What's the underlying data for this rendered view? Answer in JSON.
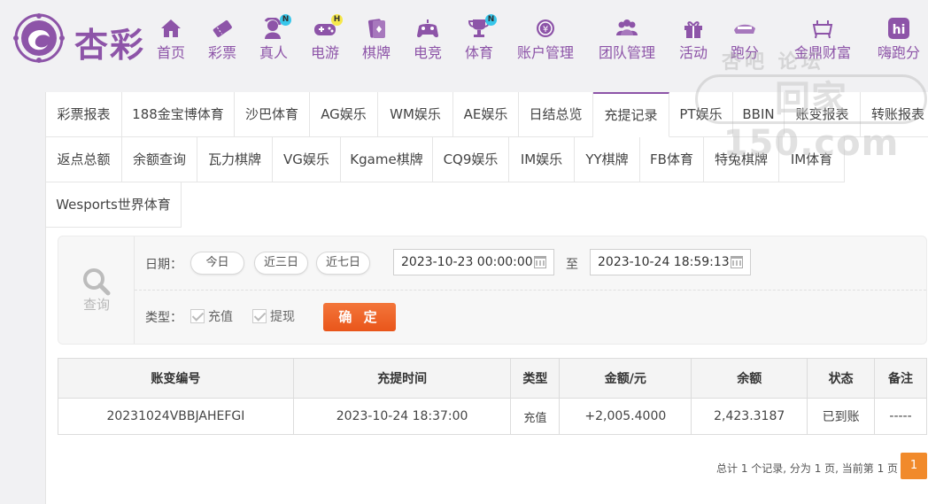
{
  "brand": {
    "name": "杏彩"
  },
  "nav": [
    {
      "label": "首页",
      "icon": "home-icon"
    },
    {
      "label": "彩票",
      "icon": "lottery-ticket-icon"
    },
    {
      "label": "真人",
      "icon": "live-dealer-icon",
      "badge": "N"
    },
    {
      "label": "电游",
      "icon": "gamepad-icon",
      "badge": "H"
    },
    {
      "label": "棋牌",
      "icon": "cards-icon"
    },
    {
      "label": "电竞",
      "icon": "esports-controller-icon"
    },
    {
      "label": "体育",
      "icon": "trophy-icon",
      "badge": "N"
    },
    {
      "label": "账户管理",
      "icon": "yen-coin-icon"
    },
    {
      "label": "团队管理",
      "icon": "team-icon"
    },
    {
      "label": "活动",
      "icon": "gift-icon"
    },
    {
      "label": "跑分",
      "icon": "running-icon"
    },
    {
      "label": "金鼎财富",
      "icon": "cauldron-icon"
    },
    {
      "label": "嗨跑分",
      "icon": "hi-app-icon"
    }
  ],
  "watermark": {
    "line1": "杏吧 论坛",
    "line2": "回家150.com"
  },
  "tabs": [
    "彩票报表",
    "188金宝博体育",
    "沙巴体育",
    "AG娱乐",
    "WM娱乐",
    "AE娱乐",
    "日结总览",
    "充提记录",
    "PT娱乐",
    "BBIN",
    "账变报表",
    "转账报表",
    "返点总额",
    "余额查询",
    "瓦力棋牌",
    "VG娱乐",
    "Kgame棋牌",
    "CQ9娱乐",
    "IM娱乐",
    "YY棋牌",
    "FB体育",
    "特兔棋牌",
    "IM体育",
    "Wesports世界体育"
  ],
  "active_tab": "充提记录",
  "query": {
    "icon_label": "查询",
    "date_label": "日期：",
    "quick_ranges": [
      "今日",
      "近三日",
      "近七日"
    ],
    "start_date": "2023-10-23 00:00:00",
    "to_label": "至",
    "end_date": "2023-10-24 18:59:13",
    "type_label": "类型：",
    "types": [
      "充值",
      "提现"
    ],
    "confirm_label": "确 定"
  },
  "table": {
    "headers": [
      "账变编号",
      "充提时间",
      "类型",
      "金额/元",
      "余额",
      "状态",
      "备注"
    ],
    "rows": [
      [
        "20231024VBBJAHEFGI",
        "2023-10-24 18:37:00",
        "充值",
        "+2,005.4000",
        "2,423.3187",
        "已到账",
        "-----"
      ]
    ]
  },
  "pager": {
    "summary": "总计 1 个记录, 分为 1 页, 当前第 1 页",
    "current": "1"
  }
}
